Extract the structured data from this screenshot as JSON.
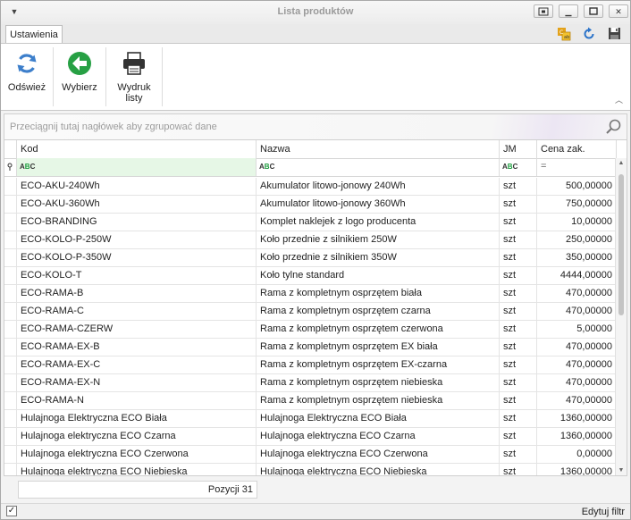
{
  "window": {
    "title": "Lista produktów",
    "sysmenu_icon": "chevron-down-icon",
    "buttons": [
      "screenshot-icon",
      "minimize-icon",
      "maximize-icon",
      "close-icon"
    ]
  },
  "tabs": [
    {
      "label": "Ustawienia"
    }
  ],
  "quick_access": [
    "translate-icon",
    "refresh-icon",
    "save-icon"
  ],
  "ribbon": {
    "buttons": [
      {
        "label": "Odśwież",
        "icon": "refresh-icon"
      },
      {
        "label": "Wybierz",
        "icon": "back-arrow-icon"
      },
      {
        "label": "Wydruk\nlisty",
        "icon": "printer-icon"
      }
    ]
  },
  "group_panel": {
    "hint": "Przeciągnij tutaj nagłówek aby zgrupować dane"
  },
  "grid": {
    "columns": [
      "Kod",
      "Nazwa",
      "JM",
      "Cena zak."
    ],
    "rows": [
      [
        "ECO-AKU-240Wh",
        "Akumulator litowo-jonowy 240Wh",
        "szt",
        "500,00000"
      ],
      [
        "ECO-AKU-360Wh",
        "Akumulator litowo-jonowy 360Wh",
        "szt",
        "750,00000"
      ],
      [
        "ECO-BRANDING",
        "Komplet naklejek z logo producenta",
        "szt",
        "10,00000"
      ],
      [
        "ECO-KOLO-P-250W",
        "Koło przednie z silnikiem 250W",
        "szt",
        "250,00000"
      ],
      [
        "ECO-KOLO-P-350W",
        "Koło przednie z silnikiem 350W",
        "szt",
        "350,00000"
      ],
      [
        "ECO-KOLO-T",
        "Koło tylne standard",
        "szt",
        "4444,00000"
      ],
      [
        "ECO-RAMA-B",
        "Rama z kompletnym osprzętem biała",
        "szt",
        "470,00000"
      ],
      [
        "ECO-RAMA-C",
        "Rama z kompletnym osprzętem czarna",
        "szt",
        "470,00000"
      ],
      [
        "ECO-RAMA-CZERW",
        "Rama z kompletnym osprzętem czerwona",
        "szt",
        "5,00000"
      ],
      [
        "ECO-RAMA-EX-B",
        "Rama z kompletnym osprzętem EX biała",
        "szt",
        "470,00000"
      ],
      [
        "ECO-RAMA-EX-C",
        "Rama z kompletnym osprzętem EX-czarna",
        "szt",
        "470,00000"
      ],
      [
        "ECO-RAMA-EX-N",
        "Rama z kompletnym osprzętem niebieska",
        "szt",
        "470,00000"
      ],
      [
        "ECO-RAMA-N",
        "Rama z kompletnym osprzętem niebieska",
        "szt",
        "470,00000"
      ],
      [
        "Hulajnoga Elektryczna ECO Biała",
        "Hulajnoga Elektryczna ECO Biała",
        "szt",
        "1360,00000"
      ],
      [
        "Hulajnoga elektryczna ECO Czarna",
        "Hulajnoga elektryczna ECO Czarna",
        "szt",
        "1360,00000"
      ],
      [
        "Hulajnoga elektryczna ECO Czerwona",
        "Hulajnoga elektryczna ECO Czerwona",
        "szt",
        "0,00000"
      ],
      [
        "Hulajnoga elektryczna ECO Niebieska",
        "Hulajnoga elektryczna ECO Niebieska",
        "szt",
        "1360,00000"
      ]
    ]
  },
  "footer": {
    "count": "Pozycji 31"
  },
  "statusbar": {
    "edit_filter": "Edytuj filtr",
    "checkbox_checked": true
  }
}
